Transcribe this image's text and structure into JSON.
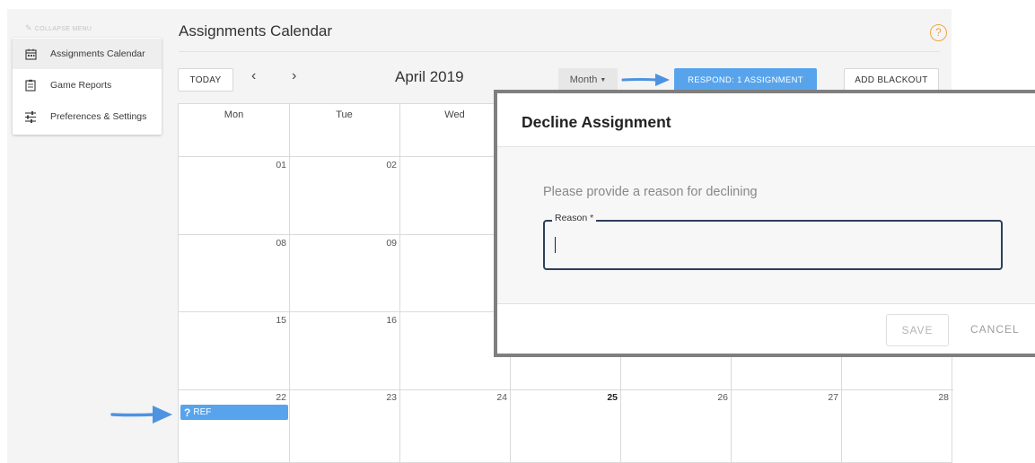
{
  "menu": {
    "toggle_label": "COLLAPSE MENU",
    "items": [
      {
        "label": "Assignments Calendar",
        "icon": "calendar-icon",
        "active": true
      },
      {
        "label": "Game Reports",
        "icon": "clipboard-icon",
        "active": false
      },
      {
        "label": "Preferences & Settings",
        "icon": "sliders-icon",
        "active": false
      }
    ]
  },
  "header": {
    "title": "Assignments Calendar",
    "help_icon": "?"
  },
  "toolbar": {
    "today_label": "TODAY",
    "prev": "‹",
    "next": "›",
    "month_title": "April 2019",
    "view_select": "Month",
    "respond_label": "RESPOND: 1 ASSIGNMENT",
    "blackout_label": "ADD BLACKOUT"
  },
  "calendar": {
    "weekdays": [
      "Mon",
      "Tue",
      "Wed"
    ],
    "days": {
      "r1": [
        "01",
        "02"
      ],
      "r2": [
        "08",
        "09"
      ],
      "r3": [
        "15",
        "16"
      ],
      "r4": [
        "22",
        "23",
        "24",
        "25",
        "26",
        "27",
        "28"
      ]
    },
    "event": {
      "mark": "?",
      "label": "REF"
    }
  },
  "dialog": {
    "title": "Decline Assignment",
    "prompt": "Please provide a reason for declining",
    "reason_label": "Reason *",
    "reason_value": "",
    "save_label": "SAVE",
    "cancel_label": "CANCEL"
  },
  "colors": {
    "accent": "#58a4ec",
    "help": "#f0a540",
    "field_border": "#2f3f5b"
  }
}
